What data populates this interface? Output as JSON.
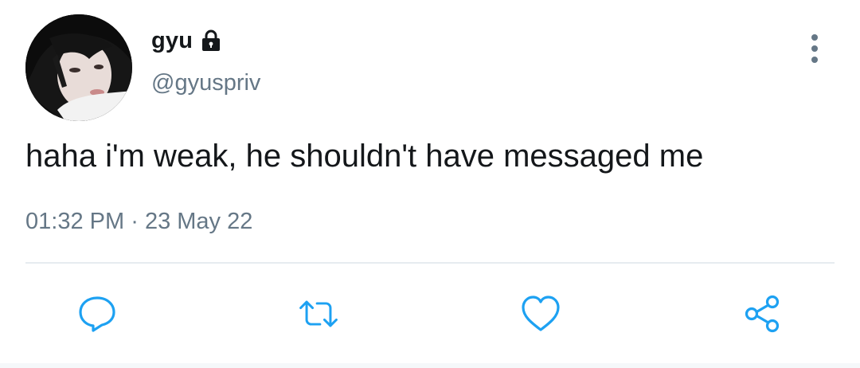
{
  "author": {
    "display_name": "gyu",
    "handle": "@gyuspriv",
    "protected_icon": "lock-icon"
  },
  "tweet": {
    "text": "haha i'm weak, he shouldn't have messaged me",
    "time": "01:32 PM",
    "separator": "·",
    "date": "23 May 22"
  },
  "actions": [
    {
      "name": "reply",
      "icon": "reply-icon"
    },
    {
      "name": "retweet",
      "icon": "retweet-icon"
    },
    {
      "name": "like",
      "icon": "heart-icon"
    },
    {
      "name": "share",
      "icon": "share-icon"
    }
  ],
  "menu_icon": "more-vertical-icon",
  "colors": {
    "text_primary": "#14171a",
    "text_secondary": "#657786",
    "icon": "#1da1f2",
    "divider": "#e6ecf0"
  }
}
